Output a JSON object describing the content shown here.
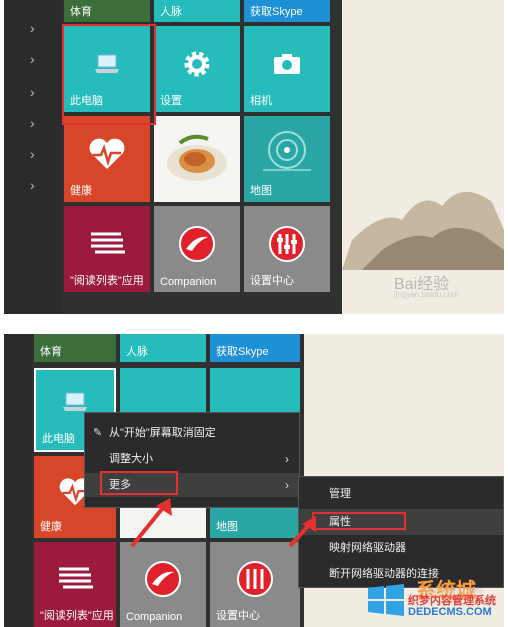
{
  "panel1": {
    "top_labels": [
      "体育",
      "人脉",
      "获取Skype"
    ],
    "tiles": {
      "this_pc": "此电脑",
      "settings": "设置",
      "camera": "相机",
      "health": "健康",
      "maps": "地图",
      "reading_list": "\"阅读列表\"应用",
      "companion": "Companion",
      "settings_center": "设置中心"
    },
    "watermark": "Bai经验",
    "watermark_url": "jingyan.baidu.com"
  },
  "panel2": {
    "top_labels": [
      "体育",
      "人脉",
      "获取Skype"
    ],
    "tiles": {
      "this_pc": "此电脑",
      "health": "健康",
      "maps": "地图",
      "reading_list": "\"阅读列表\"应用",
      "companion": "Companion",
      "settings_center": "设置中心"
    },
    "context_menu": {
      "unpin": "从\"开始\"屏幕取消固定",
      "resize": "调整大小",
      "more": "更多"
    },
    "submenu": {
      "manage": "管理",
      "properties": "属性",
      "map_drive": "映射网络驱动器",
      "disconnect_drive": "断开网络驱动器的连接"
    },
    "watermark_brand": "系统城",
    "watermark_site": "织梦内容管理系统",
    "watermark_domain": "DEDECMS.COM",
    "watermark_url": "xitongcheng.com"
  },
  "colors": {
    "teal": "#26bcbc",
    "health_red": "#d8462a",
    "reading_maroon": "#9c1b3c",
    "highlight_red": "#e53030",
    "menu_bg": "#2b2b2b"
  }
}
